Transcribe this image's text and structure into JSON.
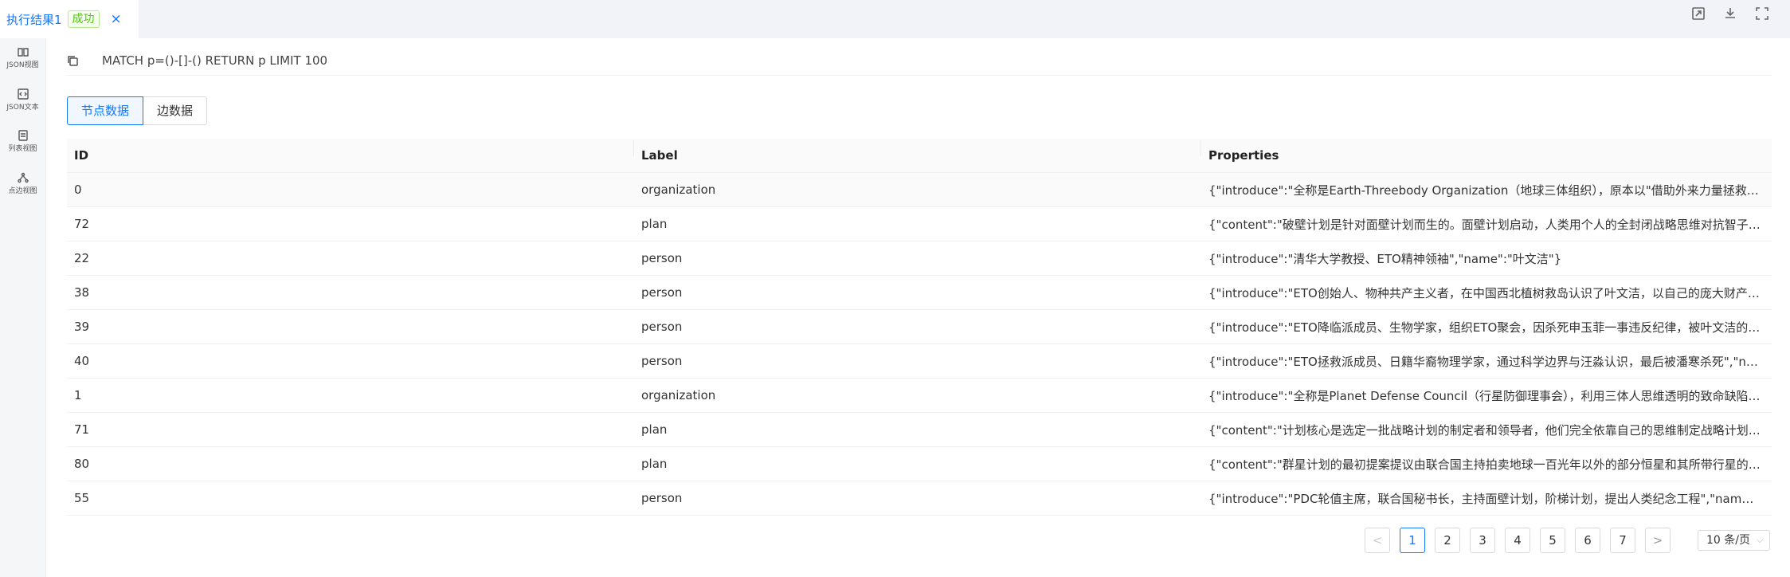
{
  "tab": {
    "title": "执行结果1",
    "badge": "成功",
    "close": "×"
  },
  "sidebar": {
    "items": [
      {
        "label": "JSON视图"
      },
      {
        "label": "JSON文本"
      },
      {
        "label": "列表视图"
      },
      {
        "label": "点边视图"
      }
    ]
  },
  "query": "MATCH p=()-[]-() RETURN p LIMIT 100",
  "subtabs": {
    "nodes": "节点数据",
    "edges": "边数据"
  },
  "table": {
    "headers": [
      "ID",
      "Label",
      "Properties"
    ],
    "rows": [
      {
        "id": "0",
        "label": "organization",
        "props": "{\"introduce\":\"全称是Earth-Threebody Organization（地球三体组织），原本以\"借助外来力量拯救腐朽的人类文明\"为目的\"}"
      },
      {
        "id": "72",
        "label": "plan",
        "props": "{\"content\":\"破壁计划是针对面壁计划而生的。面壁计划启动，人类用个人的全封闭战略思维对抗智子的监控\"}"
      },
      {
        "id": "22",
        "label": "person",
        "props": "{\"introduce\":\"清华大学教授、ETO精神领袖\",\"name\":\"叶文洁\"}"
      },
      {
        "id": "38",
        "label": "person",
        "props": "{\"introduce\":\"ETO创始人、物种共产主义者，在中国西北植树救岛认识了叶文洁，以自己的庞大财产支持\"}"
      },
      {
        "id": "39",
        "label": "person",
        "props": "{\"introduce\":\"ETO降临派成员、生物学家，组织ETO聚会，因杀死申玉菲一事违反纪律，被叶文洁的护卫\"}"
      },
      {
        "id": "40",
        "label": "person",
        "props": "{\"introduce\":\"ETO拯救派成员、日籍华裔物理学家，通过科学边界与汪淼认识，最后被潘寒杀死\",\"name\":\"申玉菲\"}"
      },
      {
        "id": "1",
        "label": "organization",
        "props": "{\"introduce\":\"全称是Planet Defense Council（行星防御理事会），利用三体人思维透明的致命缺陷，制定\"}"
      },
      {
        "id": "71",
        "label": "plan",
        "props": "{\"content\":\"计划核心是选定一批战略计划的制定者和领导者，他们完全依靠自己的思维制定战略计划\"}"
      },
      {
        "id": "80",
        "label": "plan",
        "props": "{\"content\":\"群星计划的最初提案提议由联合国主持拍卖地球一百光年以外的部分恒星和其所带行星的所有权\"}"
      },
      {
        "id": "55",
        "label": "person",
        "props": "{\"introduce\":\"PDC轮值主席，联合国秘书长，主持面壁计划，阶梯计划，提出人类纪念工程\",\"name\":\"萨伊\"}"
      }
    ]
  },
  "pagination": {
    "prev": "<",
    "next": ">",
    "pages": [
      "1",
      "2",
      "3",
      "4",
      "5",
      "6",
      "7"
    ],
    "current": "1",
    "page_size": "10 条/页"
  },
  "colors": {
    "accent": "#1677ff",
    "success": "#52c41a"
  }
}
